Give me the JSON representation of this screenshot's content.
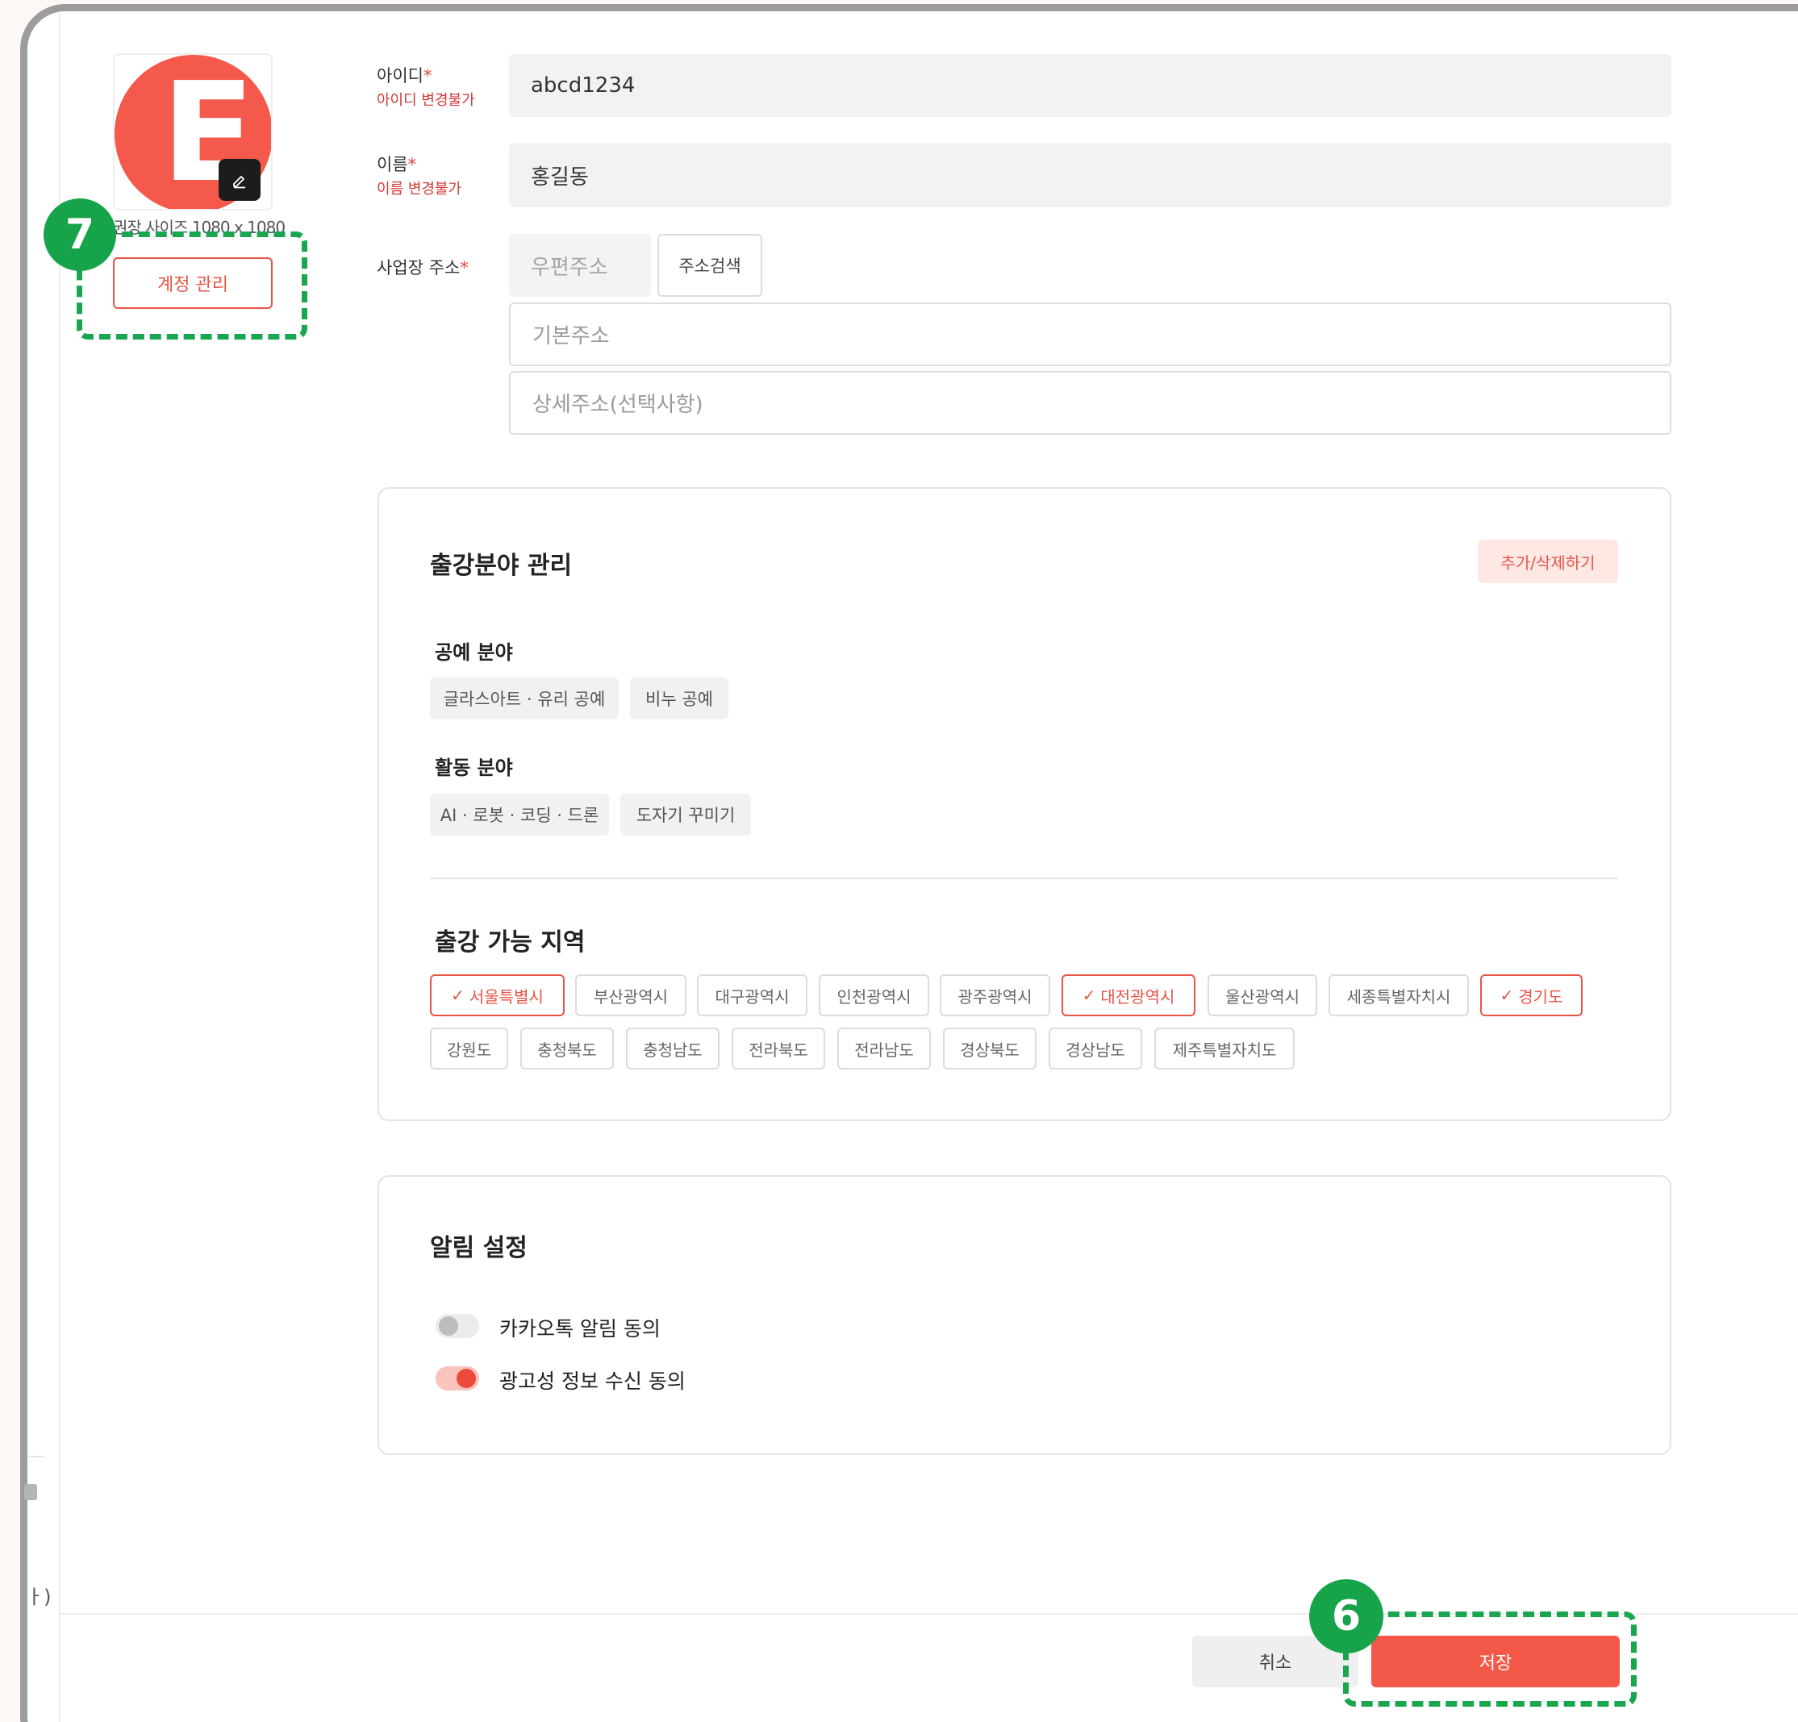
{
  "profile": {
    "avatar_letter": "E",
    "size_note": "권장 사이즈 1080 x 1080",
    "account_button": "계정 관리"
  },
  "form": {
    "id_label": "아이디",
    "id_note": "아이디 변경불가",
    "id_value": "abcd1234",
    "name_label": "이름",
    "name_note": "이름 변경불가",
    "name_value": "홍길동",
    "address_label": "사업장 주소",
    "required_mark": "*",
    "postal_placeholder": "우편주소",
    "search_button": "주소검색",
    "basic_address_placeholder": "기본주소",
    "detail_address_placeholder": "상세주소(선택사항)"
  },
  "field_card": {
    "title": "출강분야 관리",
    "edit_button": "추가/삭제하기",
    "craft_title": "공예 분야",
    "craft_tags": [
      "글라스아트 · 유리 공예",
      "비누 공예"
    ],
    "activity_title": "활동 분야",
    "activity_tags": [
      "AI · 로봇 · 코딩 · 드론",
      "도자기 꾸미기"
    ],
    "region_title": "출강 가능 지역",
    "regions_row1": [
      {
        "label": "서울특별시",
        "selected": true
      },
      {
        "label": "부산광역시",
        "selected": false
      },
      {
        "label": "대구광역시",
        "selected": false
      },
      {
        "label": "인천광역시",
        "selected": false
      },
      {
        "label": "광주광역시",
        "selected": false
      },
      {
        "label": "대전광역시",
        "selected": true
      },
      {
        "label": "울산광역시",
        "selected": false
      },
      {
        "label": "세종특별자치시",
        "selected": false
      },
      {
        "label": "경기도",
        "selected": true
      }
    ],
    "regions_row2": [
      {
        "label": "강원도",
        "selected": false
      },
      {
        "label": "충청북도",
        "selected": false
      },
      {
        "label": "충청남도",
        "selected": false
      },
      {
        "label": "전라북도",
        "selected": false
      },
      {
        "label": "전라남도",
        "selected": false
      },
      {
        "label": "경상북도",
        "selected": false
      },
      {
        "label": "경상남도",
        "selected": false
      },
      {
        "label": "제주특별자치도",
        "selected": false
      }
    ]
  },
  "notify_card": {
    "title": "알림 설정",
    "kakao_label": "카카오톡 알림 동의",
    "kakao_on": false,
    "ad_label": "광고성 정보 수신 동의",
    "ad_on": true
  },
  "footer": {
    "cancel": "취소",
    "save": "저장"
  },
  "callouts": {
    "account_number": "7",
    "save_number": "6"
  },
  "side_stub": {
    "text": "ㅏ)"
  },
  "colors": {
    "accent": "#f45848",
    "callout": "#17a34a"
  }
}
